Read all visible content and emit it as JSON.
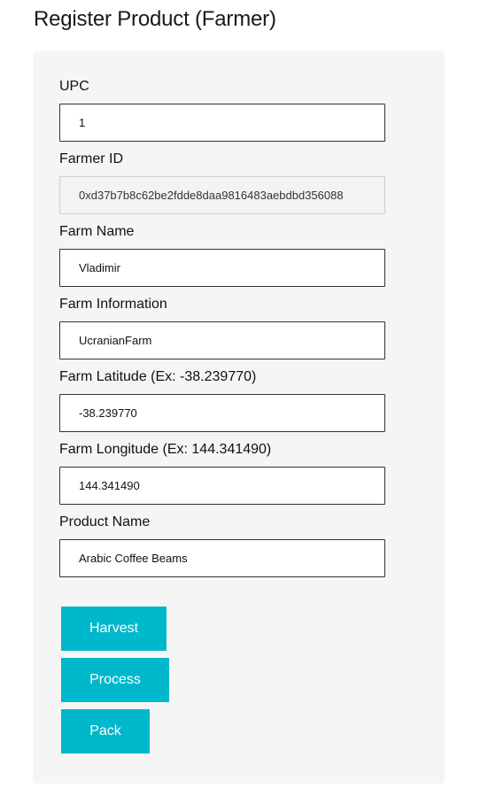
{
  "page": {
    "title": "Register Product (Farmer)"
  },
  "form": {
    "upc": {
      "label": "UPC",
      "value": "1"
    },
    "farmer_id": {
      "label": "Farmer ID",
      "value": "0xd37b7b8c62be2fdde8daa9816483aebdbd356088"
    },
    "farm_name": {
      "label": "Farm Name",
      "value": "Vladimir"
    },
    "farm_information": {
      "label": "Farm Information",
      "value": "UcranianFarm"
    },
    "farm_latitude": {
      "label": "Farm Latitude (Ex: -38.239770)",
      "value": "-38.239770"
    },
    "farm_longitude": {
      "label": "Farm Longitude (Ex: 144.341490)",
      "value": "144.341490"
    },
    "product_name": {
      "label": "Product Name",
      "value": "Arabic Coffee Beams"
    }
  },
  "actions": {
    "harvest": "Harvest",
    "process": "Process",
    "pack": "Pack"
  },
  "colors": {
    "button": "#00b8cc",
    "panel": "#f5f5f5"
  }
}
